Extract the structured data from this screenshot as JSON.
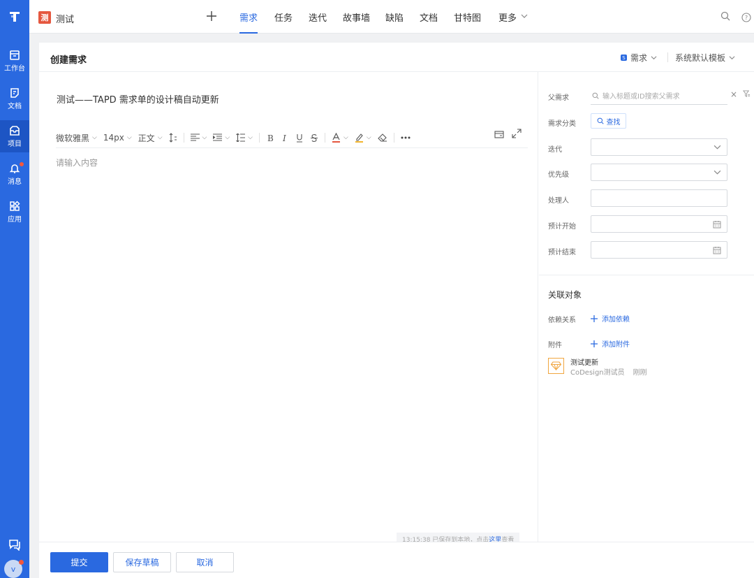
{
  "project": {
    "badge": "测",
    "name": "测试"
  },
  "nav_tabs": [
    {
      "label": "需求",
      "active": true
    },
    {
      "label": "任务"
    },
    {
      "label": "迭代"
    },
    {
      "label": "故事墙"
    },
    {
      "label": "缺陷"
    },
    {
      "label": "文档"
    },
    {
      "label": "甘特图"
    },
    {
      "label": "更多"
    }
  ],
  "rail": {
    "items": [
      {
        "label": "工作台",
        "icon": "workbench-icon"
      },
      {
        "label": "文档",
        "icon": "document-icon"
      },
      {
        "label": "项目",
        "icon": "project-icon",
        "active": true
      },
      {
        "label": "消息",
        "icon": "bell-icon"
      },
      {
        "label": "应用",
        "icon": "apps-icon"
      }
    ],
    "avatar_initial": "v"
  },
  "page": {
    "title": "创建需求",
    "type_label": "需求",
    "type_badge": "S",
    "template_label": "系统默认模板"
  },
  "editor": {
    "title_value": "测试——TAPD 需求单的设计稿自动更新",
    "font_family": "微软雅黑",
    "font_size": "14px",
    "paragraph": "正文",
    "placeholder": "请输入内容",
    "saved_prefix": "13:15:38 已保存到本地，点击",
    "saved_link": "这里",
    "saved_suffix": "查看"
  },
  "form": {
    "parent_label": "父需求",
    "parent_placeholder": "输入标题或ID搜索父需求",
    "category_label": "需求分类",
    "category_button": "查找",
    "iteration_label": "迭代",
    "priority_label": "优先级",
    "handler_label": "处理人",
    "start_label": "预计开始",
    "end_label": "预计结束"
  },
  "related": {
    "title": "关联对象",
    "dependency_label": "依赖关系",
    "dependency_action": "添加依赖",
    "attachment_label": "附件",
    "attachment_action": "添加附件",
    "attachment": {
      "name": "测试更新",
      "uploader": "CoDesign测试员",
      "time": "刚刚"
    }
  },
  "footer": {
    "submit": "提交",
    "save_draft": "保存草稿",
    "cancel": "取消"
  },
  "colors": {
    "accent": "#2a69e0",
    "rail": "#2a69e0",
    "project_badge": "#e5573f",
    "notify_dot": "#f5573c",
    "attachment_icon": "#f0a640"
  }
}
